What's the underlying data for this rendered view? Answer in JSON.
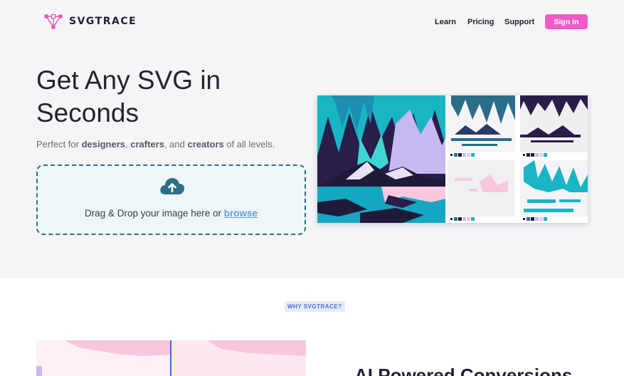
{
  "brand": {
    "name": "SVGTRACE"
  },
  "nav": {
    "learn": "Learn",
    "pricing": "Pricing",
    "support": "Support",
    "signin": "Sign In"
  },
  "hero": {
    "title_line1": "Get Any SVG in",
    "title_line2": "Seconds",
    "sub_prefix": "Perfect for ",
    "sub_b1": "designers",
    "sub_sep1": ", ",
    "sub_b2": "crafters",
    "sub_sep2": ", and ",
    "sub_b3": "creators",
    "sub_suffix": " of all levels."
  },
  "dropzone": {
    "text": "Drag & Drop your image here or ",
    "browse": "browse",
    "icon": "cloud-upload-icon"
  },
  "section": {
    "badge": "WHY SVGTRACE?",
    "heading": "AI Powered Conversions"
  },
  "colors": {
    "accent": "#f05ac8",
    "teal": "#19b5c4",
    "navy": "#1f1a3a",
    "pink": "#f9c7dd",
    "lavender": "#c8b8f0"
  }
}
